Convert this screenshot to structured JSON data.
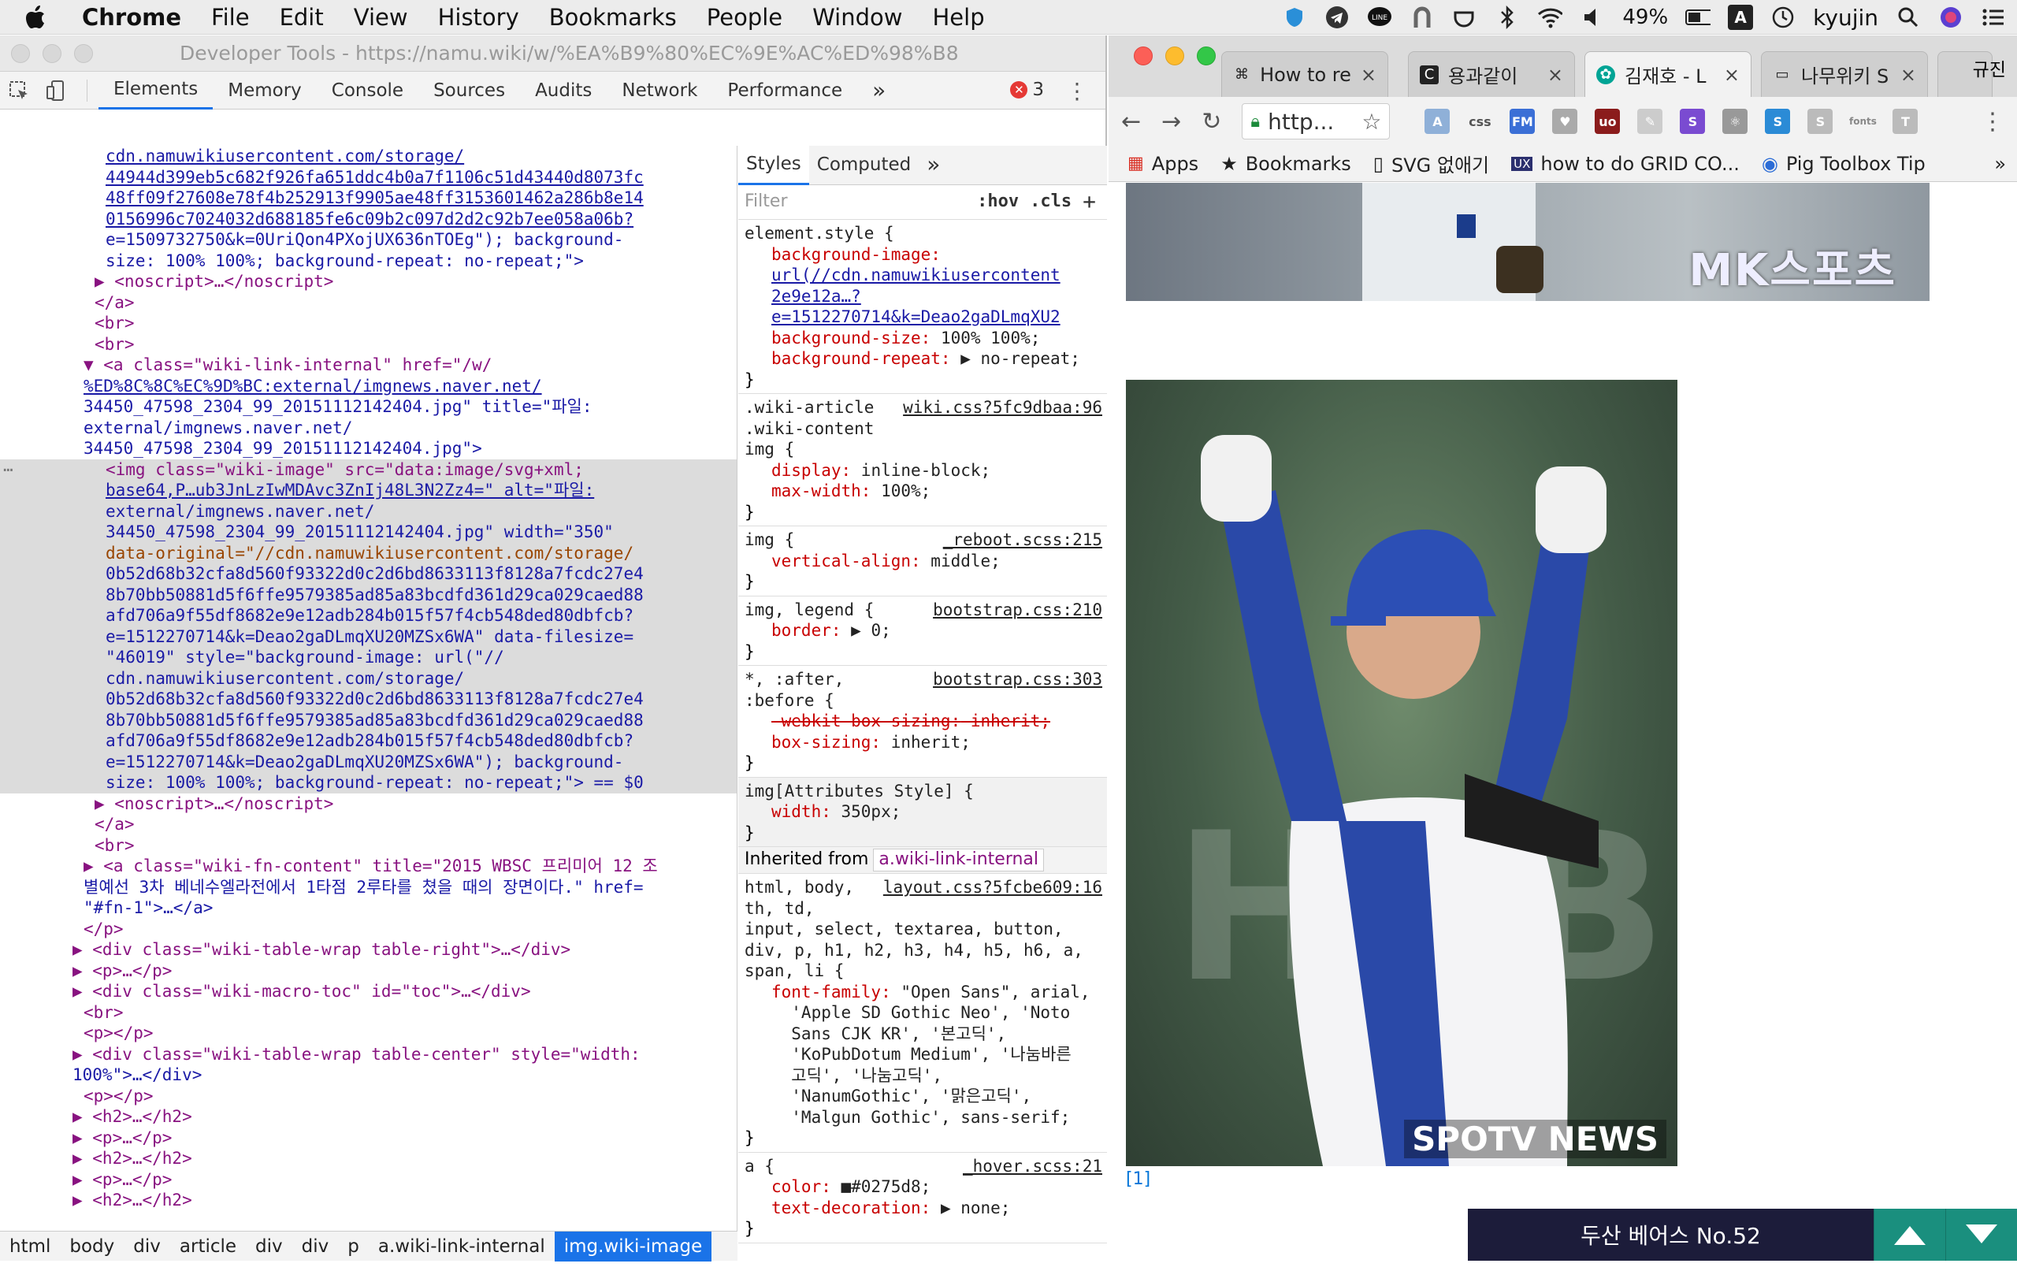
{
  "menubar": {
    "app": "Chrome",
    "items": [
      "File",
      "Edit",
      "View",
      "History",
      "Bookmarks",
      "People",
      "Window",
      "Help"
    ],
    "battery": "49%",
    "input_source": "A",
    "user": "kyujin"
  },
  "devtools": {
    "title": "Developer Tools - https://namu.wiki/w/%EA%B9%80%EC%9E%AC%ED%98%B8",
    "tabs": [
      "Elements",
      "Memory",
      "Console",
      "Sources",
      "Audits",
      "Network",
      "Performance"
    ],
    "active_tab": "Elements",
    "more_tabs": "»",
    "error_count": "3",
    "styles_tabs": [
      "Styles",
      "Computed"
    ],
    "styles_more": "»",
    "filter_placeholder": "Filter",
    "hov": ":hov",
    "cls": ".cls",
    "breadcrumbs": [
      "html",
      "body",
      "div",
      "article",
      "div",
      "div",
      "p",
      "a.wiki-link-internal",
      "img.wiki-image"
    ],
    "inherited_label": "Inherited from",
    "inherited_from": "a.wiki-link-internal"
  },
  "elements_lines": [
    {
      "indent": 134,
      "text": "cdn.namuwikiusercontent.com/storage/",
      "cls": "link"
    },
    {
      "indent": 134,
      "text": "44944d399eb5c682f926fa651ddc4b0a7f1106c51d43440d8073fc",
      "cls": "link"
    },
    {
      "indent": 134,
      "text": "48ff09f27608e78f4b252913f9905ae48ff3153601462a286b8e14",
      "cls": "link"
    },
    {
      "indent": 134,
      "text": "0156996c7024032d688185fe6c09b2c097d2d2c92b7ee058a06b?",
      "cls": "link"
    },
    {
      "indent": 134,
      "text": "e=1509732750&k=0UriQon4PXojUX636nTOEg\"); background-",
      "cls": "val"
    },
    {
      "indent": 134,
      "text": "size: 100% 100%; background-repeat: no-repeat;\">",
      "cls": "val"
    },
    {
      "indent": 120,
      "text": "▶ <noscript>…</noscript>",
      "cls": "tag"
    },
    {
      "indent": 120,
      "text": "</a>",
      "cls": "tag"
    },
    {
      "indent": 120,
      "text": "<br>",
      "cls": "tag"
    },
    {
      "indent": 120,
      "text": "<br>",
      "cls": "tag"
    },
    {
      "indent": 106,
      "text": "▼ <a class=\"wiki-link-internal\" href=\"/w/",
      "cls": "tag"
    },
    {
      "indent": 106,
      "text": "%ED%8C%8C%EC%9D%BC:external/imgnews.naver.net/",
      "cls": "link"
    },
    {
      "indent": 106,
      "text": "34450_47598_2304_99_20151112142404.jpg\" title=\"파일:",
      "cls": "val"
    },
    {
      "indent": 106,
      "text": "external/imgnews.naver.net/",
      "cls": "val"
    },
    {
      "indent": 106,
      "text": "34450_47598_2304_99_20151112142404.jpg\">",
      "cls": "val"
    },
    {
      "indent": 134,
      "text": "<img class=\"wiki-image\" src=\"data:image/svg+xml;",
      "cls": "tag",
      "hl": true,
      "dots": true
    },
    {
      "indent": 134,
      "text": "base64,P…ub3JnLzIwMDAvc3ZnIj48L3N2Zz4=\" alt=\"파일:",
      "cls": "link",
      "hl": true
    },
    {
      "indent": 134,
      "text": "external/imgnews.naver.net/",
      "cls": "val",
      "hl": true
    },
    {
      "indent": 134,
      "text": "34450_47598_2304_99_20151112142404.jpg\" width=\"350\"",
      "cls": "val",
      "hl": true
    },
    {
      "indent": 134,
      "text": "data-original=\"//cdn.namuwikiusercontent.com/storage/",
      "cls": "attr",
      "hl": true
    },
    {
      "indent": 134,
      "text": "0b52d68b32cfa8d560f93322d0c2d6bd8633113f8128a7fcdc27e4",
      "cls": "val",
      "hl": true
    },
    {
      "indent": 134,
      "text": "8b70bb50881d5f6ffe9579385ad85a83bcdfd361d29ca029caed88",
      "cls": "val",
      "hl": true
    },
    {
      "indent": 134,
      "text": "afd706a9f55df8682e9e12adb284b015f57f4cb548ded80dbfcb?",
      "cls": "val",
      "hl": true
    },
    {
      "indent": 134,
      "text": "e=1512270714&k=Deao2gaDLmqXU20MZSx6WA\" data-filesize=",
      "cls": "val",
      "hl": true
    },
    {
      "indent": 134,
      "text": "\"46019\" style=\"background-image: url(\"//",
      "cls": "val",
      "hl": true
    },
    {
      "indent": 134,
      "text": "cdn.namuwikiusercontent.com/storage/",
      "cls": "val",
      "hl": true
    },
    {
      "indent": 134,
      "text": "0b52d68b32cfa8d560f93322d0c2d6bd8633113f8128a7fcdc27e4",
      "cls": "val",
      "hl": true
    },
    {
      "indent": 134,
      "text": "8b70bb50881d5f6ffe9579385ad85a83bcdfd361d29ca029caed88",
      "cls": "val",
      "hl": true
    },
    {
      "indent": 134,
      "text": "afd706a9f55df8682e9e12adb284b015f57f4cb548ded80dbfcb?",
      "cls": "val",
      "hl": true
    },
    {
      "indent": 134,
      "text": "e=1512270714&k=Deao2gaDLmqXU20MZSx6WA\"); background-",
      "cls": "val",
      "hl": true
    },
    {
      "indent": 134,
      "text": "size: 100% 100%; background-repeat: no-repeat;\"> == $0",
      "cls": "val",
      "hl": true
    },
    {
      "indent": 120,
      "text": "▶ <noscript>…</noscript>",
      "cls": "tag"
    },
    {
      "indent": 120,
      "text": "</a>",
      "cls": "tag"
    },
    {
      "indent": 120,
      "text": "<br>",
      "cls": "tag"
    },
    {
      "indent": 106,
      "text": "▶ <a class=\"wiki-fn-content\" title=\"2015 WBSC 프리미어 12 조",
      "cls": "tag"
    },
    {
      "indent": 106,
      "text": "별예선 3차 베네수엘라전에서 1타점 2루타를 쳤을 때의 장면이다.\" href=",
      "cls": "val"
    },
    {
      "indent": 106,
      "text": "\"#fn-1\">…</a>",
      "cls": "val"
    },
    {
      "indent": 106,
      "text": "</p>",
      "cls": "tag"
    },
    {
      "indent": 92,
      "text": "▶ <div class=\"wiki-table-wrap table-right\">…</div>",
      "cls": "tag"
    },
    {
      "indent": 92,
      "text": "▶ <p>…</p>",
      "cls": "tag"
    },
    {
      "indent": 92,
      "text": "▶ <div class=\"wiki-macro-toc\" id=\"toc\">…</div>",
      "cls": "tag"
    },
    {
      "indent": 106,
      "text": "<br>",
      "cls": "tag"
    },
    {
      "indent": 106,
      "text": "<p></p>",
      "cls": "tag"
    },
    {
      "indent": 92,
      "text": "▶ <div class=\"wiki-table-wrap table-center\" style=\"width:",
      "cls": "tag"
    },
    {
      "indent": 92,
      "text": "100%\">…</div>",
      "cls": "val"
    },
    {
      "indent": 106,
      "text": "<p></p>",
      "cls": "tag"
    },
    {
      "indent": 92,
      "text": "▶ <h2>…</h2>",
      "cls": "tag"
    },
    {
      "indent": 92,
      "text": "▶ <p>…</p>",
      "cls": "tag"
    },
    {
      "indent": 92,
      "text": "▶ <h2>…</h2>",
      "cls": "tag"
    },
    {
      "indent": 92,
      "text": "▶ <p>…</p>",
      "cls": "tag"
    },
    {
      "indent": 92,
      "text": "▶ <h2>…</h2>",
      "cls": "tag"
    }
  ],
  "style_rules": [
    {
      "selector": "element.style {",
      "source": "",
      "props": [
        {
          "n": "background-image:",
          "v": ""
        },
        {
          "n": "",
          "v": "url(//cdn.namuwikiusercontent"
        },
        {
          "n": "",
          "v": "2e9e12a…?"
        },
        {
          "n": "",
          "v": "e=1512270714&k=Deao2gaDLmqXU2"
        },
        {
          "n": "background-size:",
          "v": " 100% 100%;"
        },
        {
          "n": "background-repeat:",
          "v": " ▶ no-repeat;"
        }
      ]
    },
    {
      "selector": ".wiki-article\n.wiki-content\nimg {",
      "source": "wiki.css?5fc9dbaa:96",
      "props": [
        {
          "n": "display:",
          "v": " inline-block;"
        },
        {
          "n": "max-width:",
          "v": " 100%;"
        }
      ]
    },
    {
      "selector": "img {",
      "source": "_reboot.scss:215",
      "props": [
        {
          "n": "vertical-align:",
          "v": " middle;"
        }
      ]
    },
    {
      "selector": "img, legend {",
      "source": "bootstrap.css:210",
      "props": [
        {
          "n": "border:",
          "v": " ▶ 0;"
        }
      ]
    },
    {
      "selector": "*, :after,\n:before {",
      "source": "bootstrap.css:303",
      "props": [
        {
          "n": "-webkit-box-sizing:",
          "v": " inherit;",
          "strike": true
        },
        {
          "n": "box-sizing:",
          "v": " inherit;"
        }
      ]
    },
    {
      "selector": "img[Attributes Style] {",
      "source": "",
      "gray": true,
      "props": [
        {
          "n": "width:",
          "v": " 350px;"
        }
      ]
    }
  ],
  "inherited_rules": [
    {
      "selector": "html, body,\nth, td,\ninput, select, textarea, button,\ndiv, p, h1, h2, h3, h4, h5, h6, a,\nspan, li {",
      "source": "layout.css?5fcbe609:16",
      "props": [
        {
          "n": "font-family:",
          "v": " \"Open Sans\", arial,"
        },
        {
          "n": "",
          "v": "  'Apple SD Gothic Neo', 'Noto"
        },
        {
          "n": "",
          "v": "  Sans CJK KR', '본고딕',"
        },
        {
          "n": "",
          "v": "  'KoPubDotum Medium', '나눔바른"
        },
        {
          "n": "",
          "v": "  고딕', '나눔고딕',"
        },
        {
          "n": "",
          "v": "  'NanumGothic', '맑은고딕',"
        },
        {
          "n": "",
          "v": "  'Malgun Gothic', sans-serif;"
        }
      ]
    },
    {
      "selector": "a {",
      "source": "_hover.scss:21",
      "props": [
        {
          "n": "color:",
          "v": " ■#0275d8;"
        },
        {
          "n": "text-decoration:",
          "v": " ▶ none;"
        }
      ]
    }
  ],
  "browser": {
    "tabs": [
      {
        "title": "How to re",
        "fav": "⌘"
      },
      {
        "title": "용과같이 ",
        "fav": "C"
      },
      {
        "title": "김재호 - L",
        "fav": "✿",
        "active": true
      },
      {
        "title": "나무위키 S",
        "fav": "▭"
      }
    ],
    "profile": "규진",
    "url": "http...",
    "bookmarks": [
      "Apps",
      "Bookmarks",
      "SVG 없애기",
      "how to do GRID CO...",
      "Pig Toolbox Tip"
    ],
    "image1_caption": "MK스포츠",
    "image2_caption": "SPOTV NEWS",
    "footnote": "[1]",
    "footer_label": "두산 베어스 No.52"
  }
}
